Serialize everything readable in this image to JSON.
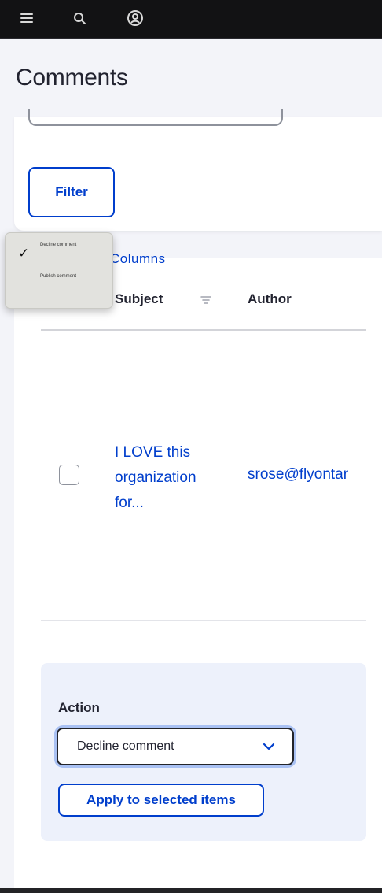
{
  "topbar": {
    "icons": [
      "menu-icon",
      "search-icon",
      "user-icon"
    ]
  },
  "page": {
    "title": "Comments"
  },
  "filter": {
    "button_label": "Filter"
  },
  "table": {
    "bulk_link_partial": "Columns",
    "columns": [
      "Subject",
      "Author"
    ],
    "rows": [
      {
        "subject": "I LOVE this organization for...",
        "subject_lines": [
          "I LOVE this",
          "organization",
          "for..."
        ],
        "author": "srose@flyontar"
      }
    ]
  },
  "actions": {
    "label": "Action",
    "selected": "Decline comment",
    "apply_label": "Apply to selected items"
  },
  "dropdown_menu": {
    "options": [
      "Decline comment",
      "Publish comment"
    ],
    "checked_index": 0
  },
  "colors": {
    "link": "#003ecc",
    "topbar": "#121214",
    "card": "#ffffff"
  }
}
